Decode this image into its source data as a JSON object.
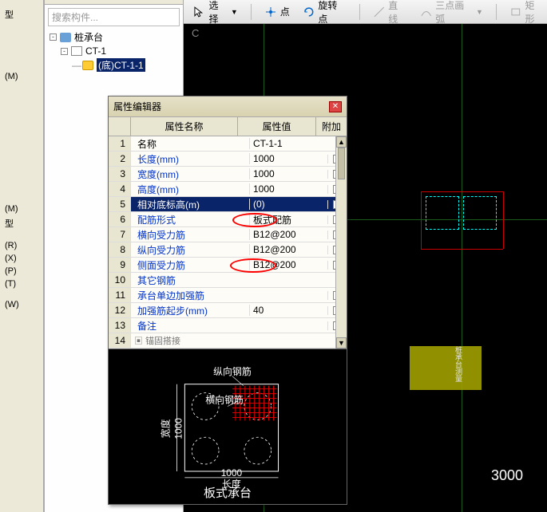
{
  "toolbar": {
    "select": "选择",
    "point": "点",
    "rotatePoint": "旋转点",
    "line": "直线",
    "threePointArc": "三点画弧",
    "rect": "矩形"
  },
  "search": {
    "placeholder": "搜索构件..."
  },
  "tree": {
    "root": "桩承台",
    "child1": "CT-1",
    "child2": "(底)CT-1-1"
  },
  "gutter": {
    "items": [
      "型",
      "(M)",
      "",
      "",
      "",
      "",
      "",
      "",
      "",
      "(M)",
      "型",
      "(R)",
      "(X)",
      "(P)",
      "(T)",
      "",
      "(W)"
    ]
  },
  "propWin": {
    "title": "属性编辑器",
    "headers": {
      "name": "属性名称",
      "value": "属性值",
      "add": "附加"
    },
    "rows": [
      {
        "n": "1",
        "name": "名称",
        "val": "CT-1-1",
        "chk": false,
        "black": true
      },
      {
        "n": "2",
        "name": "长度(mm)",
        "val": "1000",
        "chk": true
      },
      {
        "n": "3",
        "name": "宽度(mm)",
        "val": "1000",
        "chk": true
      },
      {
        "n": "4",
        "name": "高度(mm)",
        "val": "1000",
        "chk": true
      },
      {
        "n": "5",
        "name": "相对底标高(m)",
        "val": "(0)",
        "chk": true,
        "sel": true
      },
      {
        "n": "6",
        "name": "配筋形式",
        "val": "板式配筋",
        "chk": true
      },
      {
        "n": "7",
        "name": "横向受力筋",
        "val": "B12@200",
        "chk": true
      },
      {
        "n": "8",
        "name": "纵向受力筋",
        "val": "B12@200",
        "chk": true
      },
      {
        "n": "9",
        "name": "侧面受力筋",
        "val": "B12@200",
        "chk": true
      },
      {
        "n": "10",
        "name": "其它钢筋",
        "val": "",
        "chk": false
      },
      {
        "n": "11",
        "name": "承台单边加强筋",
        "val": "",
        "chk": true
      },
      {
        "n": "12",
        "name": "加强筋起步(mm)",
        "val": "40",
        "chk": true
      },
      {
        "n": "13",
        "name": "备注",
        "val": "",
        "chk": true
      }
    ],
    "row14": {
      "n": "14",
      "name": "锚固搭接"
    }
  },
  "diagram": {
    "vert_lbl": "纵向钢筋",
    "horz_lbl": "横向钢筋",
    "width_lbl": "宽度",
    "width_dim": "1000",
    "len_lbl": "长度",
    "len_dim": "1000",
    "caption": "板式承台"
  },
  "canvas": {
    "marker": "C",
    "dim": "3000"
  }
}
